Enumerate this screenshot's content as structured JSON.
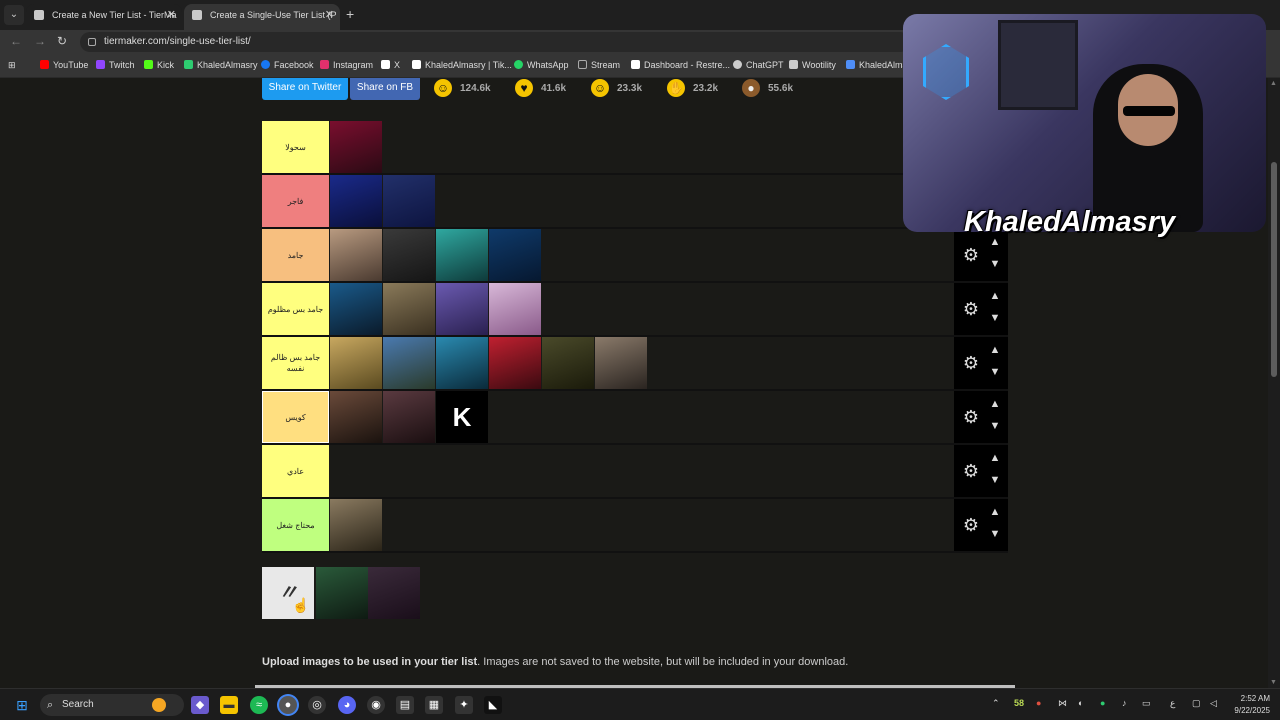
{
  "browser": {
    "tabs": [
      {
        "label": "Create a New Tier List - TierMa",
        "active": false
      },
      {
        "label": "Create a Single-Use Tier List (P",
        "active": true
      }
    ],
    "url": "tiermaker.com/single-use-tier-list/",
    "bookmarks": [
      {
        "label": "YouTube",
        "color": "#ff0000"
      },
      {
        "label": "Twitch",
        "color": "#9146ff"
      },
      {
        "label": "Kick",
        "color": "#53fc18"
      },
      {
        "label": "KhaledAlmasry",
        "color": "#2ecc71"
      },
      {
        "label": "Facebook",
        "color": "#1877f2"
      },
      {
        "label": "Instagram",
        "color": "#e1306c"
      },
      {
        "label": "X",
        "color": "#ffffff"
      },
      {
        "label": "KhaledAlmasry | Tik...",
        "color": "#ffffff"
      },
      {
        "label": "WhatsApp",
        "color": "#25d366"
      },
      {
        "label": "Stream",
        "color": "#888888"
      },
      {
        "label": "Dashboard - Restre...",
        "color": "#ffffff"
      },
      {
        "label": "ChatGPT",
        "color": "#cccccc"
      },
      {
        "label": "Wootility",
        "color": "#cccccc"
      },
      {
        "label": "KhaledAlmas",
        "color": "#4f8ef7"
      }
    ]
  },
  "share": {
    "twitter": "Share on Twitter",
    "facebook": "Share on FB"
  },
  "reactions": [
    {
      "icon": "laughing-face-icon",
      "count": "124.6k",
      "color": "#f5c400"
    },
    {
      "icon": "heart-eyes-face-icon",
      "count": "41.6k",
      "color": "#f5c400"
    },
    {
      "icon": "grin-face-icon",
      "count": "23.3k",
      "color": "#f5c400"
    },
    {
      "icon": "praying-hands-icon",
      "count": "23.2k",
      "color": "#f5c400"
    },
    {
      "icon": "poop-icon",
      "count": "55.6k",
      "color": "#8b5a2b"
    }
  ],
  "tiers": [
    {
      "label": "سحولا",
      "color": "#ffff7f",
      "items": 1
    },
    {
      "label": "فاجر",
      "color": "#ef7f7f",
      "items": 2
    },
    {
      "label": "جامد",
      "color": "#f7bf7f",
      "items": 4
    },
    {
      "label": "جامد بس مظلوم",
      "color": "#ffff7f",
      "items": 4
    },
    {
      "label": "جامد بس ظالم نفسه",
      "color": "#ffff7f",
      "items": 6
    },
    {
      "label": "كويس",
      "color": "#ffdf80",
      "items": 3,
      "selected": true
    },
    {
      "label": "عادي",
      "color": "#ffff7f",
      "items": 0
    },
    {
      "label": "محتاج شغل",
      "color": "#bfff7f",
      "items": 1
    }
  ],
  "pool_items": 3,
  "upload_note": {
    "bold": "Upload images to be used in your tier list",
    "rest": ". Images are not saved to the website, but will be included in your download."
  },
  "webcam": {
    "name": "KhaledAlmasry"
  },
  "taskbar": {
    "search": "Search",
    "tray_number": "58",
    "lang": "ع",
    "time": "2:52 AM",
    "date": "9/22/2025"
  }
}
